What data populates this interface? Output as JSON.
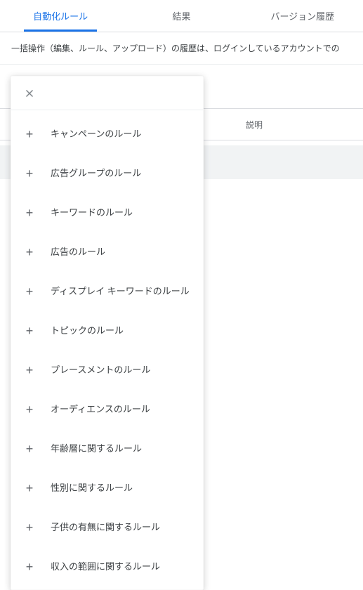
{
  "tabs": {
    "automation": "自動化ルール",
    "results": "結果",
    "history": "バージョン履歴"
  },
  "info_bar": "一括操作（編集、ルール、アップロード）の履歴は、ログインしているアカウントでの",
  "table": {
    "col_description": "説明"
  },
  "menu": {
    "items": [
      {
        "label": "キャンペーンのルール"
      },
      {
        "label": "広告グループのルール"
      },
      {
        "label": "キーワードのルール"
      },
      {
        "label": "広告のルール"
      },
      {
        "label": "ディスプレイ キーワードのルール"
      },
      {
        "label": "トピックのルール"
      },
      {
        "label": "プレースメントのルール"
      },
      {
        "label": "オーディエンスのルール"
      },
      {
        "label": "年齢層に関するルール"
      },
      {
        "label": "性別に関するルール"
      },
      {
        "label": "子供の有無に関するルール"
      },
      {
        "label": "収入の範囲に関するルール"
      }
    ]
  }
}
